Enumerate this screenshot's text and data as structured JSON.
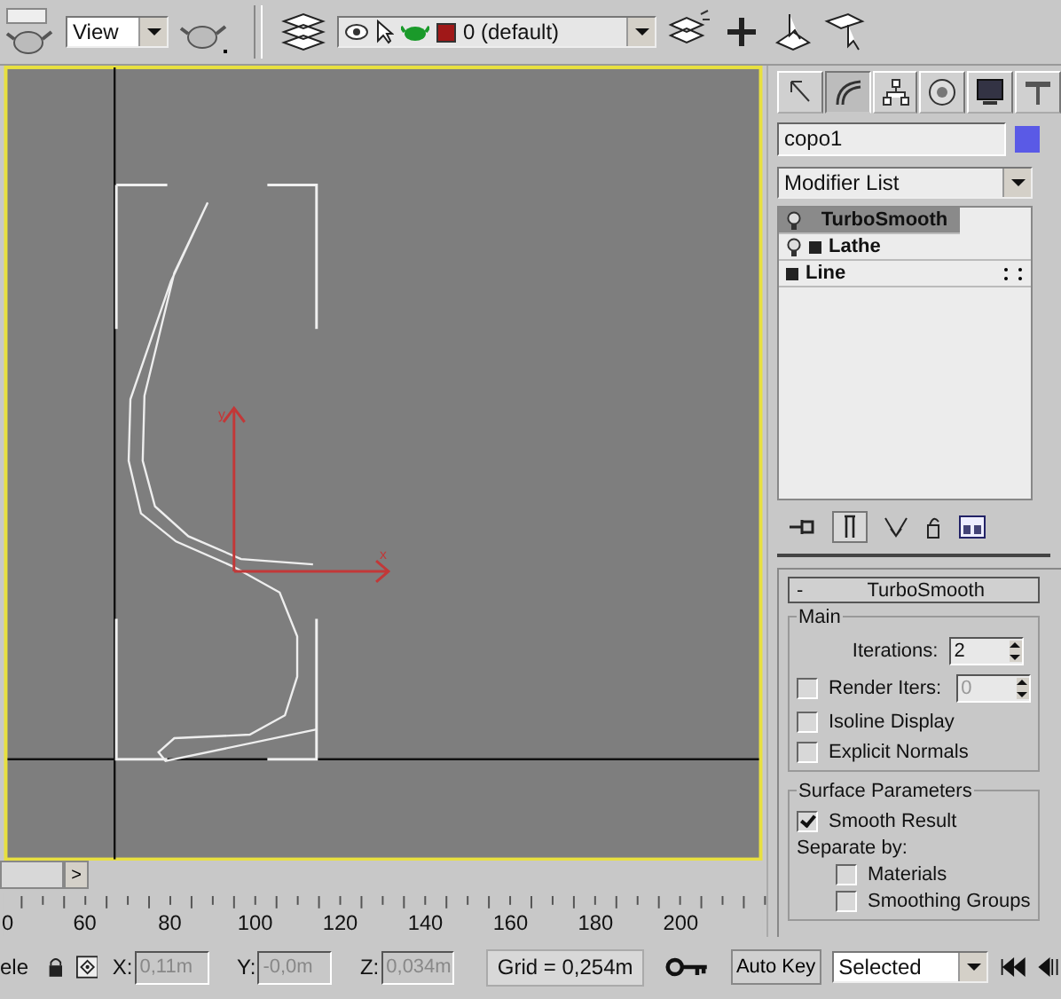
{
  "toolbar": {
    "view_dropdown": "View",
    "layer_dropdown": "0 (default)"
  },
  "viewport": {
    "axis_labels": [
      {
        "kind": "y",
        "text": "y"
      },
      {
        "kind": "x",
        "text": "x"
      }
    ]
  },
  "timeline": {
    "scroll_button": ">",
    "ruler_labels": [
      "0",
      "60",
      "80",
      "100",
      "120",
      "140",
      "160",
      "180",
      "200"
    ]
  },
  "command_panel": {
    "tabs": [
      {
        "kind": "create",
        "selected": false
      },
      {
        "kind": "modify",
        "selected": true
      },
      {
        "kind": "hierarchy",
        "selected": false
      },
      {
        "kind": "motion",
        "selected": false
      },
      {
        "kind": "display",
        "selected": false
      },
      {
        "kind": "utilities",
        "selected": false
      }
    ],
    "object_name": "copo1",
    "modifier_list": "Modifier List",
    "stack": [
      {
        "label": "TurboSmooth",
        "bulb": true,
        "expandable": false,
        "selected": true
      },
      {
        "label": "Lathe",
        "bulb": true,
        "expandable": true,
        "selected": false
      },
      {
        "label": "Line",
        "bulb": false,
        "expandable": true,
        "selected": false
      }
    ],
    "rollout": {
      "collapse": "-",
      "title": "TurboSmooth",
      "main_group": "Main",
      "iterations_label": "Iterations:",
      "iterations": "2",
      "render_iters": {
        "label": "Render Iters:",
        "checked": false,
        "value": "0",
        "disabled": true
      },
      "checks": [
        {
          "label": "Isoline Display",
          "checked": false
        },
        {
          "label": "Explicit Normals",
          "checked": false
        }
      ],
      "surface_group": "Surface Parameters",
      "smooth_result": {
        "label": "Smooth Result",
        "checked": true
      },
      "separate_label": "Separate by:",
      "separate": [
        {
          "label": "Materials",
          "checked": false
        },
        {
          "label": "Smoothing Groups",
          "checked": false
        }
      ]
    }
  },
  "status_bar": {
    "prompt": "ele",
    "x_label": "X:",
    "x": "0,11m",
    "y_label": "Y:",
    "y": "-0,0m",
    "z_label": "Z:",
    "z": "0,034m",
    "grid": "Grid = 0,254m",
    "auto_key": "Auto Key",
    "key_mode": "Selected"
  }
}
